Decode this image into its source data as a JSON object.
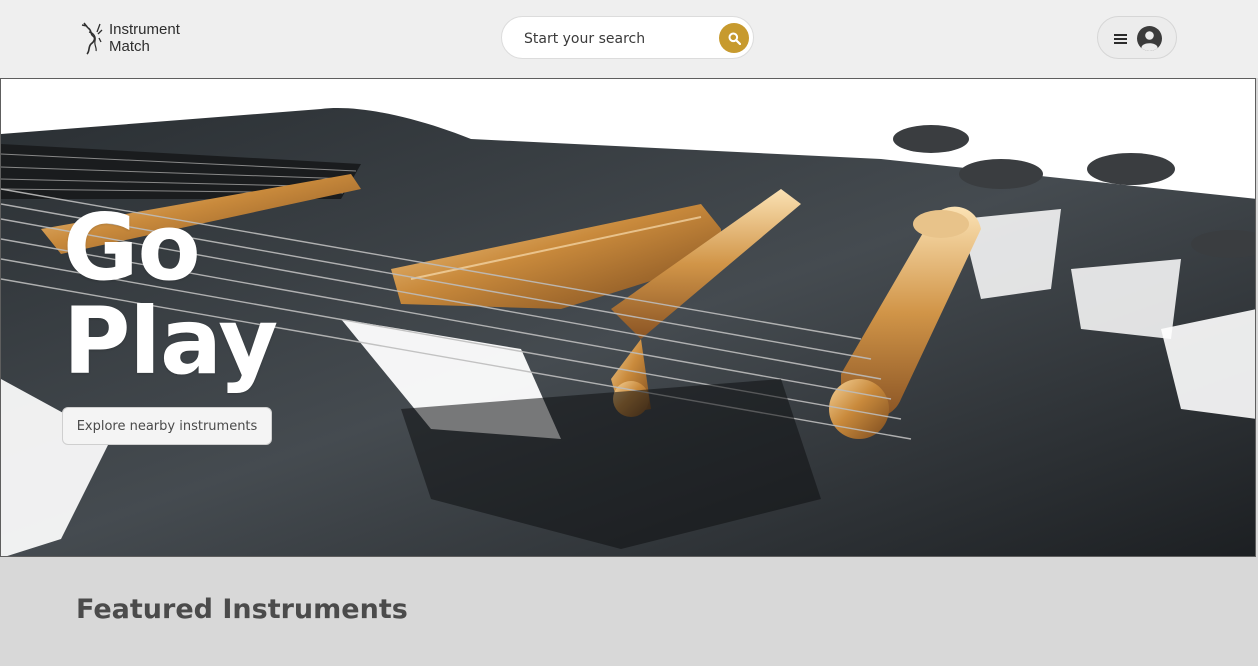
{
  "header": {
    "logo": {
      "line1": "Instrument",
      "line2": "Match"
    },
    "search": {
      "placeholder": "Start your search",
      "button_color": "#c79a2e"
    },
    "icons": {
      "search": "search-icon",
      "menu": "hamburger-menu-icon",
      "user": "user-avatar-icon"
    }
  },
  "hero": {
    "title_line1": "Go",
    "title_line2": "Play",
    "cta_label": "Explore nearby instruments",
    "background": "electric-guitar-bridge-photo"
  },
  "featured": {
    "title": "Featured Instruments"
  },
  "colors": {
    "accent": "#c79a2e",
    "header_bg": "#efefef",
    "page_bg": "#d8d8d8",
    "title_text": "#4b4b4b"
  }
}
